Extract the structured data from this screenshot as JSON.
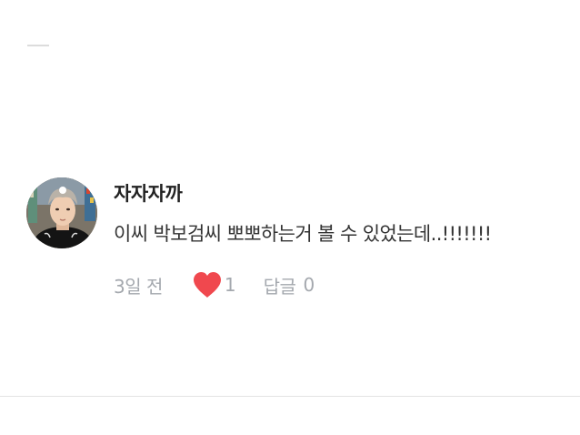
{
  "comment": {
    "author": "자자자까",
    "text": "이씨 박보검씨 뽀뽀하는거 볼 수 있었는데..!!!!!!!",
    "time": "3일 전",
    "like_count": "1",
    "like_icon": "heart-icon",
    "reply_label": "답글",
    "reply_count": "0",
    "colors": {
      "heart": "#f0484e",
      "meta": "#a4a8ae",
      "author": "#222222",
      "text": "#333333"
    }
  }
}
